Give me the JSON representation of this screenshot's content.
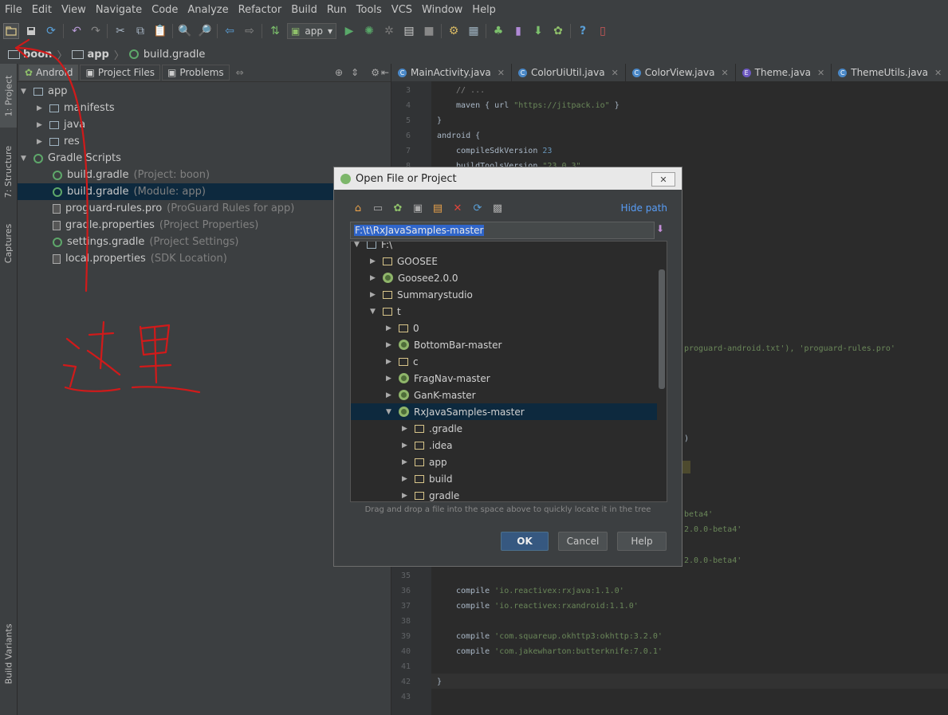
{
  "menu": [
    "File",
    "Edit",
    "View",
    "Navigate",
    "Code",
    "Analyze",
    "Refactor",
    "Build",
    "Run",
    "Tools",
    "VCS",
    "Window",
    "Help"
  ],
  "toolbar": {
    "run_config": "app",
    "run_config_arrow": "▾"
  },
  "breadcrumb": [
    "boon",
    "app",
    "build.gradle"
  ],
  "left_strip": {
    "project": "1: Project",
    "structure": "7: Structure",
    "captures": "Captures",
    "build_variants": "Build Variants"
  },
  "project_panel": {
    "tabs": [
      "Android",
      "Project Files",
      "Problems"
    ],
    "tree": [
      {
        "label": "app",
        "hint": ""
      },
      {
        "label": "manifests",
        "hint": ""
      },
      {
        "label": "java",
        "hint": ""
      },
      {
        "label": "res",
        "hint": ""
      },
      {
        "label": "Gradle Scripts",
        "hint": ""
      },
      {
        "label": "build.gradle",
        "hint": "(Project: boon)"
      },
      {
        "label": "build.gradle",
        "hint": "(Module: app)"
      },
      {
        "label": "proguard-rules.pro",
        "hint": "(ProGuard Rules for app)"
      },
      {
        "label": "gradle.properties",
        "hint": "(Project Properties)"
      },
      {
        "label": "settings.gradle",
        "hint": "(Project Settings)"
      },
      {
        "label": "local.properties",
        "hint": "(SDK Location)"
      }
    ]
  },
  "editor_tabs": [
    "MainActivity.java",
    "ColorUiUtil.java",
    "ColorView.java",
    "Theme.java",
    "ThemeUtils.java"
  ],
  "editor": {
    "lines": [
      {
        "n": "3",
        "t": "// ..."
      },
      {
        "n": "4",
        "t": "maven { url ",
        "s": "\"https://jitpack.io\"",
        "e": " }"
      },
      {
        "n": "5",
        "t": "}"
      },
      {
        "n": "6",
        "t": "android {"
      },
      {
        "n": "7",
        "t": "compileSdkVersion ",
        "num": "23"
      },
      {
        "n": "8",
        "t": "buildToolsVersion ",
        "s": "\"23.0.3\""
      }
    ],
    "fragments": {
      "proguard": "proguard-android.txt'), 'proguard-rules.pro'",
      "paren": ")",
      "beta1": "beta4'",
      "beta2": "2.0.0-beta4'",
      "beta3": "2.0.0-beta4'"
    },
    "lower_lines": [
      {
        "n": "35",
        "t": ""
      },
      {
        "n": "36",
        "t": "compile ",
        "s": "'io.reactivex:rxjava:1.1.0'"
      },
      {
        "n": "37",
        "t": "compile ",
        "s": "'io.reactivex:rxandroid:1.1.0'"
      },
      {
        "n": "38",
        "t": ""
      },
      {
        "n": "39",
        "t": "compile ",
        "s": "'com.squareup.okhttp3:okhttp:3.2.0'"
      },
      {
        "n": "40",
        "t": "compile ",
        "s": "'com.jakewharton:butterknife:7.0.1'"
      },
      {
        "n": "41",
        "t": ""
      },
      {
        "n": "42",
        "t": "}"
      },
      {
        "n": "43",
        "t": ""
      }
    ]
  },
  "dialog": {
    "title": "Open File or Project",
    "close": "✕",
    "hide_path": "Hide path",
    "path": "F:\\t\\RxJavaSamples-master",
    "tree": [
      {
        "label": "F:\\",
        "type": "folder",
        "expanded": true
      },
      {
        "label": "GOOSEE",
        "type": "folder"
      },
      {
        "label": "Goosee2.0.0",
        "type": "android"
      },
      {
        "label": "Summarystudio",
        "type": "folder"
      },
      {
        "label": "t",
        "type": "folder",
        "expanded": true
      },
      {
        "label": "0",
        "type": "folder"
      },
      {
        "label": "BottomBar-master",
        "type": "android"
      },
      {
        "label": "c",
        "type": "folder"
      },
      {
        "label": "FragNav-master",
        "type": "android"
      },
      {
        "label": "GanK-master",
        "type": "android"
      },
      {
        "label": "RxJavaSamples-master",
        "type": "android",
        "expanded": true,
        "selected": true
      },
      {
        "label": ".gradle",
        "type": "folder"
      },
      {
        "label": ".idea",
        "type": "folder"
      },
      {
        "label": "app",
        "type": "folder"
      },
      {
        "label": "build",
        "type": "folder"
      },
      {
        "label": "gradle",
        "type": "folder"
      }
    ],
    "drag_hint": "Drag and drop a file into the space above to quickly locate it in the tree",
    "ok": "OK",
    "cancel": "Cancel",
    "help": "Help"
  },
  "colors": {
    "annotation": "#d11a1a",
    "selection": "#0d293e",
    "link": "#589df6"
  }
}
